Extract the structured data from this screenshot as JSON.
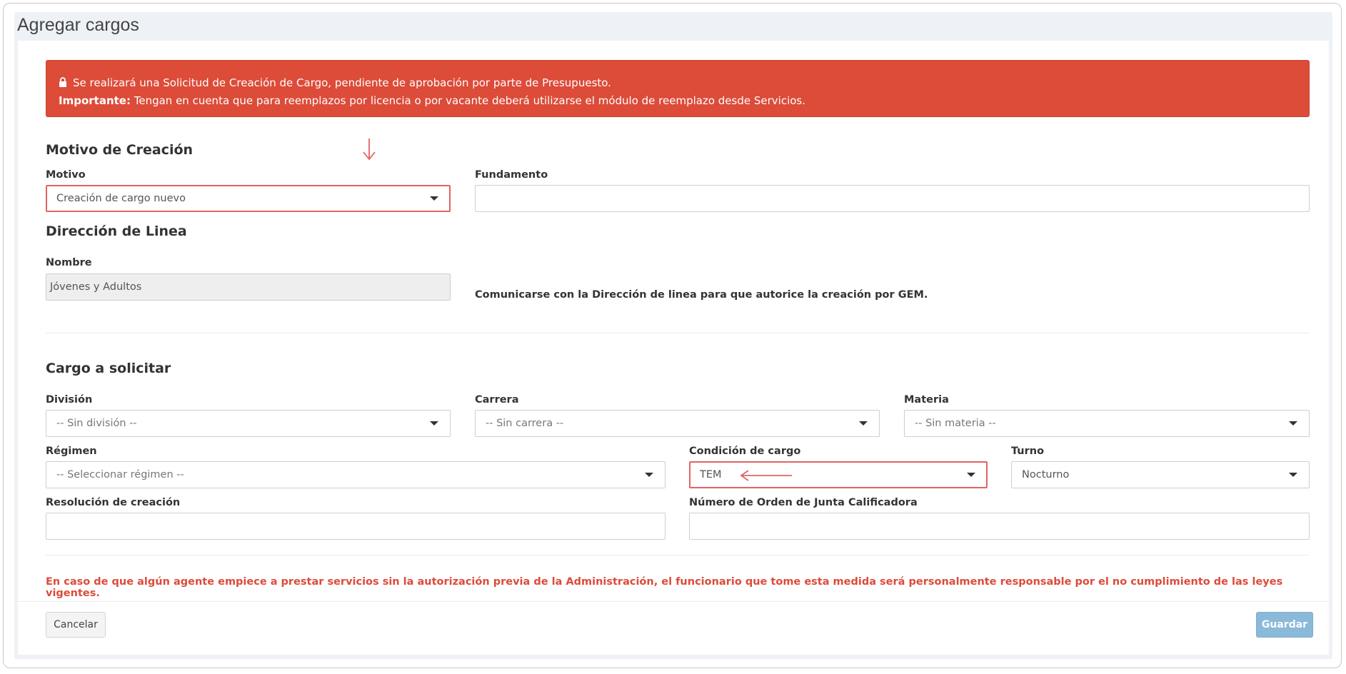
{
  "page": {
    "title": "Agregar cargos"
  },
  "alert": {
    "line1": "Se realizará una Solicitud de Creación de Cargo, pendiente de aprobación por parte de Presupuesto.",
    "line2_strong": "Importante:",
    "line2": " Tengan en cuenta que para reemplazos por licencia o por vacante deberá utilizarse el módulo de reemplazo desde Servicios.",
    "icon": "lock-icon",
    "color": "#dd4b39"
  },
  "motivo_section": {
    "heading": "Motivo de Creación",
    "motivo_label": "Motivo",
    "motivo_value": "Creación de cargo nuevo",
    "fundamento_label": "Fundamento",
    "fundamento_value": ""
  },
  "direccion_section": {
    "heading": "Dirección de Linea",
    "nombre_label": "Nombre",
    "nombre_value": "Jóvenes y Adultos",
    "note": "Comunicarse con la Dirección de linea para que autorice la creación por GEM."
  },
  "cargo_section": {
    "heading": "Cargo a solicitar",
    "division_label": "División",
    "division_value": "-- Sin división --",
    "carrera_label": "Carrera",
    "carrera_value": "-- Sin carrera --",
    "materia_label": "Materia",
    "materia_value": "-- Sin materia --",
    "regimen_label": "Régimen",
    "regimen_value": "-- Seleccionar régimen --",
    "condicion_label": "Condición de cargo",
    "condicion_value": "TEM",
    "turno_label": "Turno",
    "turno_value": "Nocturno",
    "resolucion_label": "Resolución de creación",
    "resolucion_value": "",
    "orden_label": "Número de Orden de Junta Calificadora",
    "orden_value": ""
  },
  "warning": "En caso de que algún agente empiece a prestar servicios sin la autorización previa de la Administración, el funcionario que tome esta medida será personalmente responsable por el no cumplimiento de las leyes vigentes.",
  "buttons": {
    "cancel": "Cancelar",
    "save": "Guardar"
  },
  "colors": {
    "highlight": "#e06464",
    "save_button": "#8ab9d9",
    "warning_text": "#dd4b39"
  }
}
